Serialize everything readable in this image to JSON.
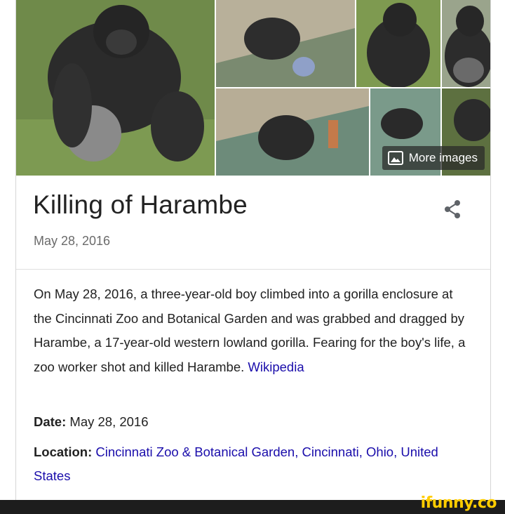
{
  "panel": {
    "more_images_label": "More images",
    "title": "Killing of Harambe",
    "subtitle": "May 28, 2016",
    "description_text": "On May 28, 2016, a three-year-old boy climbed into a gorilla enclosure at the Cincinnati Zoo and Botanical Garden and was grabbed and dragged by Harambe, a 17-year-old western lowland gorilla. Fearing for the boy's life, a zoo worker shot and killed Harambe. ",
    "description_source": "Wikipedia",
    "facts": [
      {
        "label": "Date:",
        "value": "May 28, 2016",
        "is_link": false
      },
      {
        "label": "Location:",
        "value": "Cincinnati Zoo & Botanical Garden, Cincinnati, Ohio, United States",
        "is_link": true
      }
    ]
  },
  "watermark": {
    "text": "ifunny.co"
  },
  "colors": {
    "link": "#1a0dab",
    "title": "#222222",
    "subtitle": "#6b6b6b",
    "watermark": "#ffcc00"
  },
  "icons": [
    "image-icon",
    "share-icon"
  ]
}
